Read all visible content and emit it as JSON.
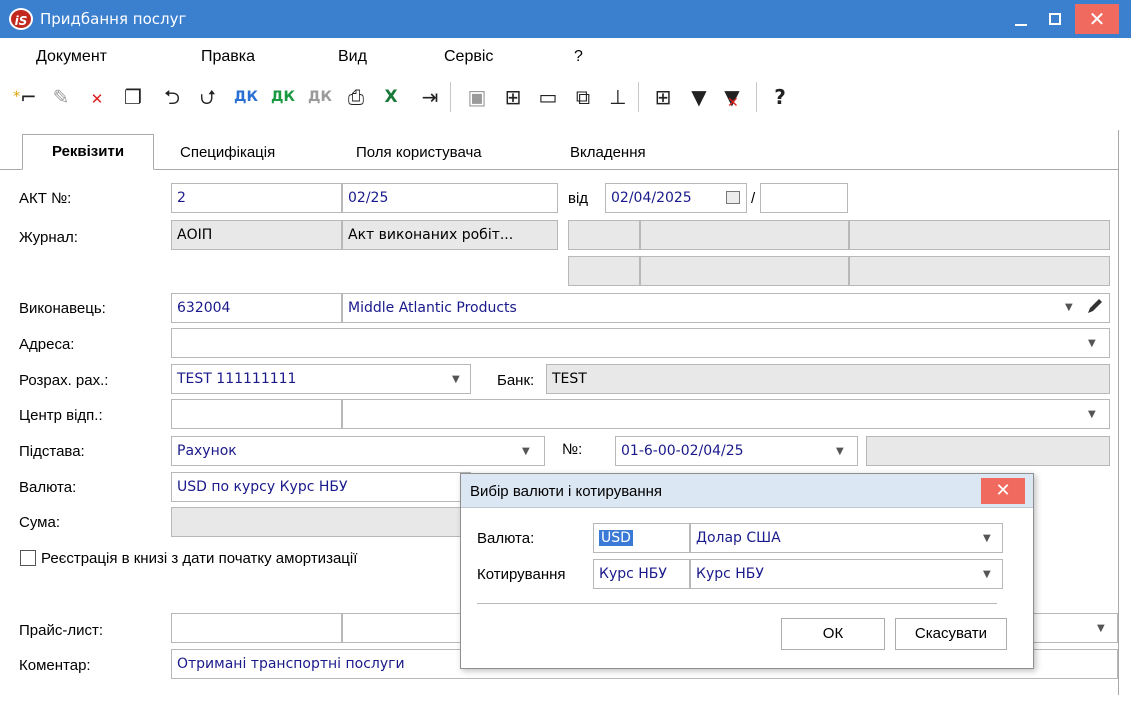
{
  "window": {
    "logo_text": "iS",
    "title": "Придбання послуг"
  },
  "menu": [
    "Документ",
    "Правка",
    "Вид",
    "Сервіс",
    "?"
  ],
  "tabs": [
    "Реквізити",
    "Специфікація",
    "Поля користувача",
    "Вкладення"
  ],
  "form": {
    "akt": {
      "label": "АКТ №:",
      "num": "2",
      "code": "02/25",
      "from_label": "від",
      "date": "02/04/2025",
      "slash": "/",
      "extra": ""
    },
    "journal": {
      "label": "Журнал:",
      "code": "АОІП",
      "name": "Акт виконаних робіт..."
    },
    "executor": {
      "label": "Виконавець:",
      "code": "632004",
      "name": "Middle Atlantic Products"
    },
    "address": {
      "label": "Адреса:",
      "value": ""
    },
    "account": {
      "label": "Розрах. рах.:",
      "value": "TEST 111111111",
      "bank_label": "Банк:",
      "bank": "TEST"
    },
    "center": {
      "label": "Центр відп.:",
      "code": "",
      "name": ""
    },
    "basis": {
      "label": "Підстава:",
      "value": "Рахунок",
      "no_label": "№:",
      "no_value": "01-6-00-02/04/25",
      "extra": ""
    },
    "currency": {
      "label": "Валюта:",
      "value": "USD по курсу Курс НБУ"
    },
    "sum": {
      "label": "Сума:",
      "value": ""
    },
    "registration_checkbox": "Реєстрація в книзі з дати початку амортизації",
    "price_list": {
      "label": "Прайс-лист:",
      "code": "",
      "name": ""
    },
    "comment": {
      "label": "Коментар:",
      "value": "Отримані транспортні послуги"
    }
  },
  "dialog": {
    "title": "Вибір валюти і котирування",
    "currency_label": "Валюта:",
    "currency_code": "USD",
    "currency_name": "Долар США",
    "quote_label": "Котирування",
    "quote_code": "Курс НБУ",
    "quote_name": "Курс НБУ",
    "ok": "ОК",
    "cancel": "Скасувати"
  },
  "icons": [
    "new-doc-icon",
    "edit-doc-icon",
    "delete-doc-icon",
    "copy-doc-icon",
    "import-icon",
    "export-icon",
    "dk-icon",
    "dk-green-icon",
    "dk-gray-icon",
    "print-icon",
    "excel-icon",
    "exit-icon",
    "save-icon",
    "book-icon",
    "folder-icon",
    "link-icon",
    "tree-icon",
    "grid-icon",
    "filter-icon",
    "clear-filter-icon",
    "help-icon"
  ]
}
